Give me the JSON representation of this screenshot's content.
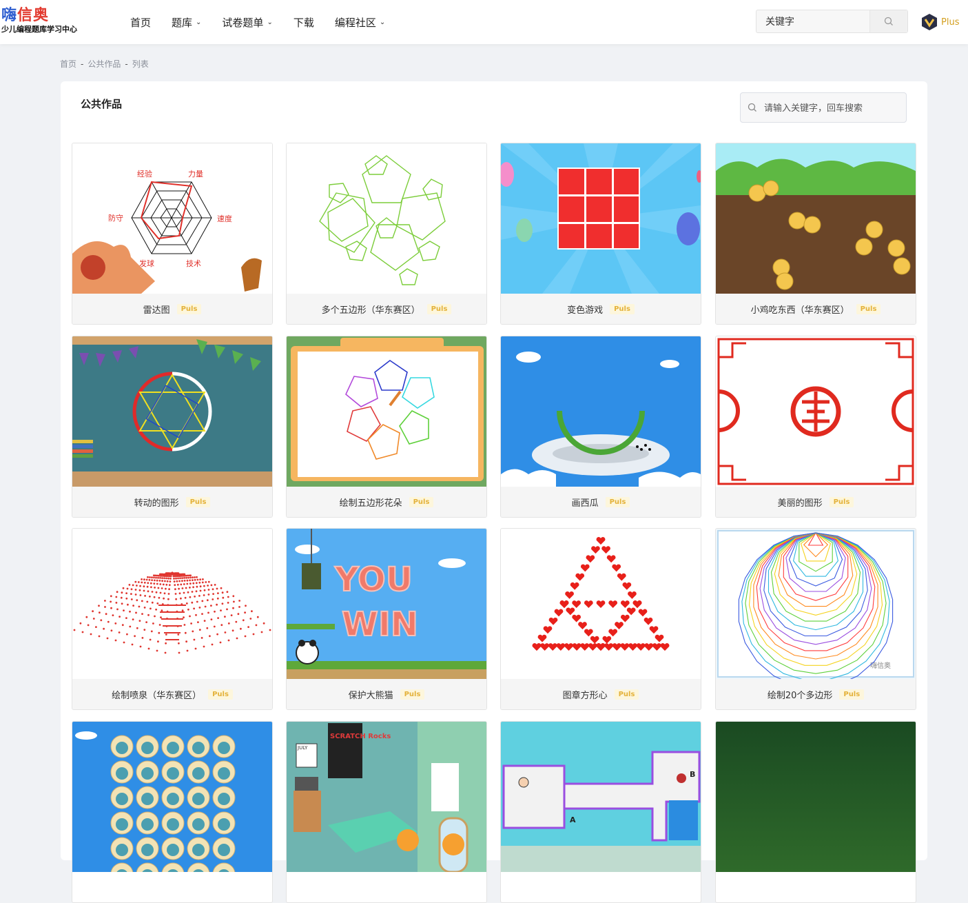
{
  "header": {
    "logo_main_a": "嗨",
    "logo_main_b": "信奥",
    "logo_sub": "少儿编程题库学习中心",
    "nav": [
      {
        "label": "首页",
        "dropdown": false
      },
      {
        "label": "题库",
        "dropdown": true
      },
      {
        "label": "试卷题单",
        "dropdown": true
      },
      {
        "label": "下载",
        "dropdown": false
      },
      {
        "label": "编程社区",
        "dropdown": true
      }
    ],
    "search_placeholder": "关键字",
    "plus_label": "Plus"
  },
  "breadcrumb": [
    "首页",
    "公共作品",
    "列表"
  ],
  "panel": {
    "title": "公共作品",
    "search_placeholder": "请输入关键字，回车搜索"
  },
  "badge_label": "Puls",
  "radar_labels": [
    "经验",
    "力量",
    "速度",
    "技术",
    "发球",
    "防守"
  ],
  "watermark": "嗨信奥",
  "room_poster": "SCRATCH Rocks",
  "room_calendar": "JULY",
  "youwin": [
    "YOU",
    "WIN"
  ],
  "maze_labels": [
    "A",
    "B"
  ],
  "cards": [
    {
      "title": "雷达图"
    },
    {
      "title": "多个五边形（华东赛区）"
    },
    {
      "title": "变色游戏"
    },
    {
      "title": "小鸡吃东西（华东赛区）"
    },
    {
      "title": "转动的图形"
    },
    {
      "title": "绘制五边形花朵"
    },
    {
      "title": "画西瓜"
    },
    {
      "title": "美丽的图形"
    },
    {
      "title": "绘制喷泉（华东赛区）"
    },
    {
      "title": "保护大熊猫"
    },
    {
      "title": "图章方形心"
    },
    {
      "title": "绘制20个多边形"
    },
    {
      "title": ""
    },
    {
      "title": ""
    },
    {
      "title": ""
    },
    {
      "title": ""
    }
  ]
}
